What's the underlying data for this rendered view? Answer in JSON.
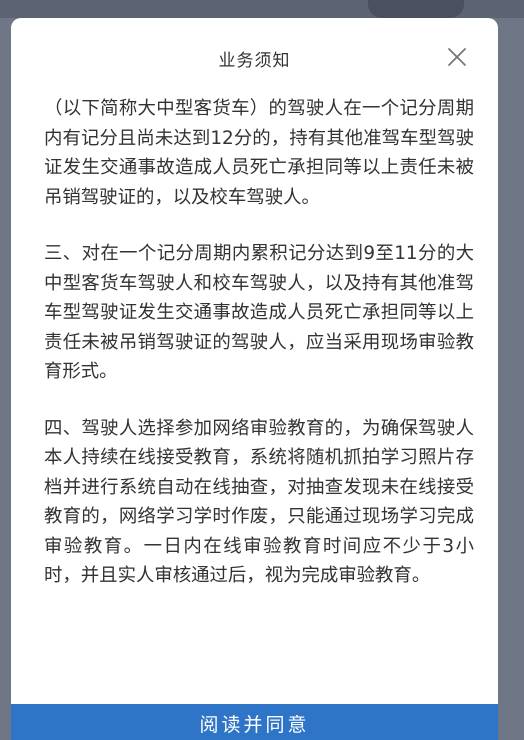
{
  "dialog": {
    "title": "业务须知",
    "paragraphs": [
      "（以下简称大中型客货车）的驾驶人在一个记分周期内有记分且尚未达到12分的，持有其他准驾车型驾驶证发生交通事故造成人员死亡承担同等以上责任未被吊销驾驶证的，以及校车驾驶人。",
      "三、对在一个记分周期内累积记分达到9至11分的大中型客货车驾驶人和校车驾驶人，以及持有其他准驾车型驾驶证发生交通事故造成人员死亡承担同等以上责任未被吊销驾驶证的驾驶人，应当采用现场审验教育形式。",
      "四、驾驶人选择参加网络审验教育的，为确保驾驶人本人持续在线接受教育，系统将随机抓拍学习照片存档并进行系统自动在线抽查，对抽查发现未在线接受教育的，网络学习学时作废，只能通过现场学习完成审验教育。一日内在线审验教育时间应不少于3小时，并且实人审核通过后，视为完成审验教育。"
    ],
    "confirm_label": "阅读并同意",
    "close_icon": "close-icon"
  },
  "colors": {
    "backdrop": "#6f7686",
    "dialog_bg": "#ffffff",
    "text": "#333333",
    "button_bg": "#2e74c7",
    "button_text": "#ffffff"
  }
}
